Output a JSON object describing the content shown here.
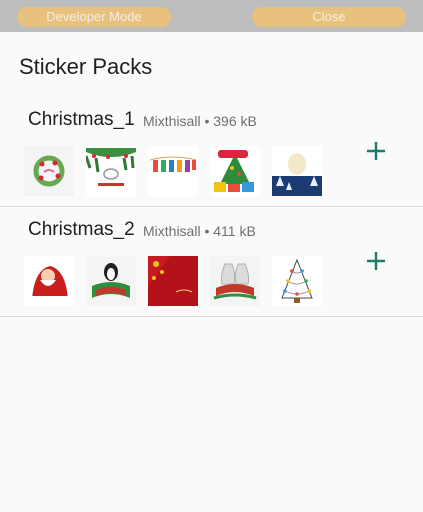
{
  "top_buttons": {
    "developer_mode": "Developer Mode",
    "close": "Close"
  },
  "page": {
    "title": "Sticker Packs"
  },
  "packs": [
    {
      "name": "Christmas_1",
      "publisher": "Mixthisall",
      "size": "396 kB",
      "stickers": [
        "xmas-wreath-icon",
        "xmas-garland-icon",
        "xmas-stockings-icon",
        "xmas-tree-gifts-icon",
        "xmas-snow-scene-icon"
      ]
    },
    {
      "name": "Christmas_2",
      "publisher": "Mixthisall",
      "size": "411 kB",
      "stickers": [
        "santa-icon",
        "penguin-banner-icon",
        "xmas-red-card-icon",
        "xmas-bells-icon",
        "xmas-lights-tree-icon"
      ]
    }
  ],
  "colors": {
    "accent": "#1e7b6b",
    "top_button": "#e8c17e",
    "top_bar": "#bdbdbd"
  }
}
